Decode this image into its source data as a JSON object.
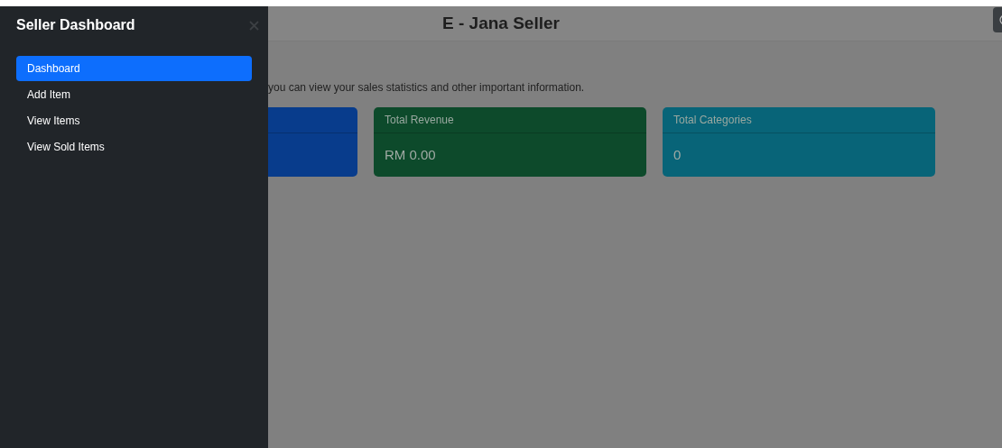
{
  "sidebar": {
    "title": "Seller Dashboard",
    "items": [
      {
        "label": "Dashboard",
        "selected": true
      },
      {
        "label": "Add Item",
        "selected": false
      },
      {
        "label": "View Items",
        "selected": false
      },
      {
        "label": "View Sold Items",
        "selected": false
      }
    ]
  },
  "header": {
    "title": "E - Jana Seller"
  },
  "description": "you can view your sales statistics and other important information.",
  "cards": [
    {
      "color": "#083c8c"
    },
    {
      "title": "Total Revenue",
      "value": "RM 0.00",
      "color": "#0d4a2b"
    },
    {
      "title": "Total Categories",
      "value": "0",
      "color": "#086478"
    }
  ]
}
